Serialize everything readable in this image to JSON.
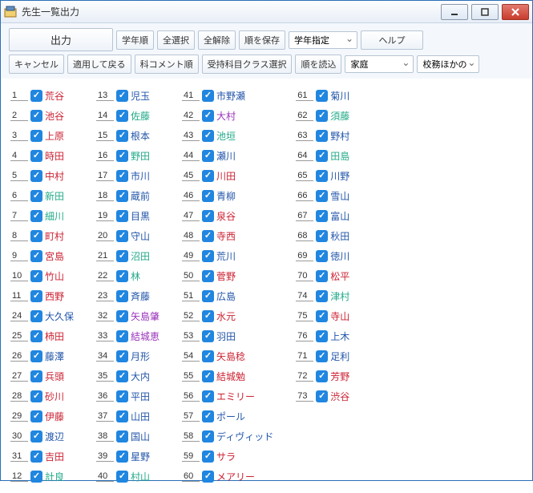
{
  "titlebar": {
    "title": "先生一覧出力"
  },
  "toolbar": {
    "row1": {
      "output": "出力",
      "grade_order": "学年順",
      "select_all": "全選択",
      "deselect_all": "全解除",
      "save_order": "順を保存",
      "grade_select": "学年指定",
      "help": "ヘルプ"
    },
    "row2": {
      "cancel": "キャンセル",
      "apply_back": "適用して戻る",
      "subject_comment_order": "科コメント順",
      "class_select": "受持科目クラス選択",
      "load_order": "順を読込",
      "household": "家庭",
      "school_affairs": "校務ほかの"
    }
  },
  "columns": [
    [
      {
        "n": "1",
        "name": "荒谷",
        "c": "#c23"
      },
      {
        "n": "2",
        "name": "池谷",
        "c": "#c23"
      },
      {
        "n": "3",
        "name": "上原",
        "c": "#c23"
      },
      {
        "n": "4",
        "name": "時田",
        "c": "#c23"
      },
      {
        "n": "5",
        "name": "中村",
        "c": "#c23"
      },
      {
        "n": "6",
        "name": "新田",
        "c": "#2a8"
      },
      {
        "n": "7",
        "name": "細川",
        "c": "#2a8"
      },
      {
        "n": "8",
        "name": "町村",
        "c": "#c23"
      },
      {
        "n": "9",
        "name": "宮島",
        "c": "#c23"
      },
      {
        "n": "10",
        "name": "竹山",
        "c": "#c23"
      },
      {
        "n": "11",
        "name": "西野",
        "c": "#c23"
      },
      {
        "n": "24",
        "name": "大久保",
        "c": "#25a"
      },
      {
        "n": "25",
        "name": "柿田",
        "c": "#c23"
      },
      {
        "n": "26",
        "name": "藤澤",
        "c": "#25a"
      },
      {
        "n": "27",
        "name": "兵頭",
        "c": "#c23"
      },
      {
        "n": "28",
        "name": "砂川",
        "c": "#c23"
      },
      {
        "n": "29",
        "name": "伊藤",
        "c": "#c23"
      },
      {
        "n": "30",
        "name": "渡辺",
        "c": "#25a"
      },
      {
        "n": "31",
        "name": "吉田",
        "c": "#c23"
      },
      {
        "n": "12",
        "name": "計良",
        "c": "#2a8"
      }
    ],
    [
      {
        "n": "13",
        "name": "児玉",
        "c": "#25a"
      },
      {
        "n": "14",
        "name": "佐藤",
        "c": "#2a8"
      },
      {
        "n": "15",
        "name": "根本",
        "c": "#25a"
      },
      {
        "n": "16",
        "name": "野田",
        "c": "#2a8"
      },
      {
        "n": "17",
        "name": "市川",
        "c": "#25a"
      },
      {
        "n": "18",
        "name": "蔵前",
        "c": "#25a"
      },
      {
        "n": "19",
        "name": "目黒",
        "c": "#25a"
      },
      {
        "n": "20",
        "name": "守山",
        "c": "#25a"
      },
      {
        "n": "21",
        "name": "沼田",
        "c": "#2a8"
      },
      {
        "n": "22",
        "name": "林",
        "c": "#2a8"
      },
      {
        "n": "23",
        "name": "斉藤",
        "c": "#25a"
      },
      {
        "n": "32",
        "name": "矢島肇",
        "c": "#93b"
      },
      {
        "n": "33",
        "name": "結城恵",
        "c": "#93b"
      },
      {
        "n": "34",
        "name": "月形",
        "c": "#25a"
      },
      {
        "n": "35",
        "name": "大内",
        "c": "#25a"
      },
      {
        "n": "36",
        "name": "平田",
        "c": "#25a"
      },
      {
        "n": "37",
        "name": "山田",
        "c": "#25a"
      },
      {
        "n": "38",
        "name": "国山",
        "c": "#25a"
      },
      {
        "n": "39",
        "name": "星野",
        "c": "#25a"
      },
      {
        "n": "40",
        "name": "村山",
        "c": "#2a8"
      }
    ],
    [
      {
        "n": "41",
        "name": "市野瀬",
        "c": "#25a"
      },
      {
        "n": "42",
        "name": "大村",
        "c": "#93b"
      },
      {
        "n": "43",
        "name": "池垣",
        "c": "#2a8"
      },
      {
        "n": "44",
        "name": "瀬川",
        "c": "#25a"
      },
      {
        "n": "45",
        "name": "川田",
        "c": "#c23"
      },
      {
        "n": "46",
        "name": "青柳",
        "c": "#25a"
      },
      {
        "n": "47",
        "name": "泉谷",
        "c": "#c23"
      },
      {
        "n": "48",
        "name": "寺西",
        "c": "#c23"
      },
      {
        "n": "49",
        "name": "荒川",
        "c": "#25a"
      },
      {
        "n": "50",
        "name": "菅野",
        "c": "#c23"
      },
      {
        "n": "51",
        "name": "広島",
        "c": "#25a"
      },
      {
        "n": "52",
        "name": "水元",
        "c": "#c23"
      },
      {
        "n": "53",
        "name": "羽田",
        "c": "#25a"
      },
      {
        "n": "54",
        "name": "矢島稔",
        "c": "#c23"
      },
      {
        "n": "55",
        "name": "結城勉",
        "c": "#c23"
      },
      {
        "n": "56",
        "name": "エミリー",
        "c": "#c23"
      },
      {
        "n": "57",
        "name": "ポール",
        "c": "#25a"
      },
      {
        "n": "58",
        "name": "ディヴィッド",
        "c": "#25a"
      },
      {
        "n": "59",
        "name": "サラ",
        "c": "#c23"
      },
      {
        "n": "60",
        "name": "メアリー",
        "c": "#c23"
      }
    ],
    [
      {
        "n": "61",
        "name": "菊川",
        "c": "#25a"
      },
      {
        "n": "62",
        "name": "須藤",
        "c": "#2a8"
      },
      {
        "n": "63",
        "name": "野村",
        "c": "#25a"
      },
      {
        "n": "64",
        "name": "田島",
        "c": "#2a8"
      },
      {
        "n": "65",
        "name": "川野",
        "c": "#25a"
      },
      {
        "n": "66",
        "name": "雪山",
        "c": "#25a"
      },
      {
        "n": "67",
        "name": "富山",
        "c": "#25a"
      },
      {
        "n": "68",
        "name": "秋田",
        "c": "#25a"
      },
      {
        "n": "69",
        "name": "徳川",
        "c": "#25a"
      },
      {
        "n": "70",
        "name": "松平",
        "c": "#c23"
      },
      {
        "n": "74",
        "name": "津村",
        "c": "#2a8"
      },
      {
        "n": "75",
        "name": "寺山",
        "c": "#c23"
      },
      {
        "n": "76",
        "name": "上木",
        "c": "#25a"
      },
      {
        "n": "71",
        "name": "足利",
        "c": "#25a"
      },
      {
        "n": "72",
        "name": "芳野",
        "c": "#c23"
      },
      {
        "n": "73",
        "name": "渋谷",
        "c": "#c23"
      }
    ]
  ]
}
